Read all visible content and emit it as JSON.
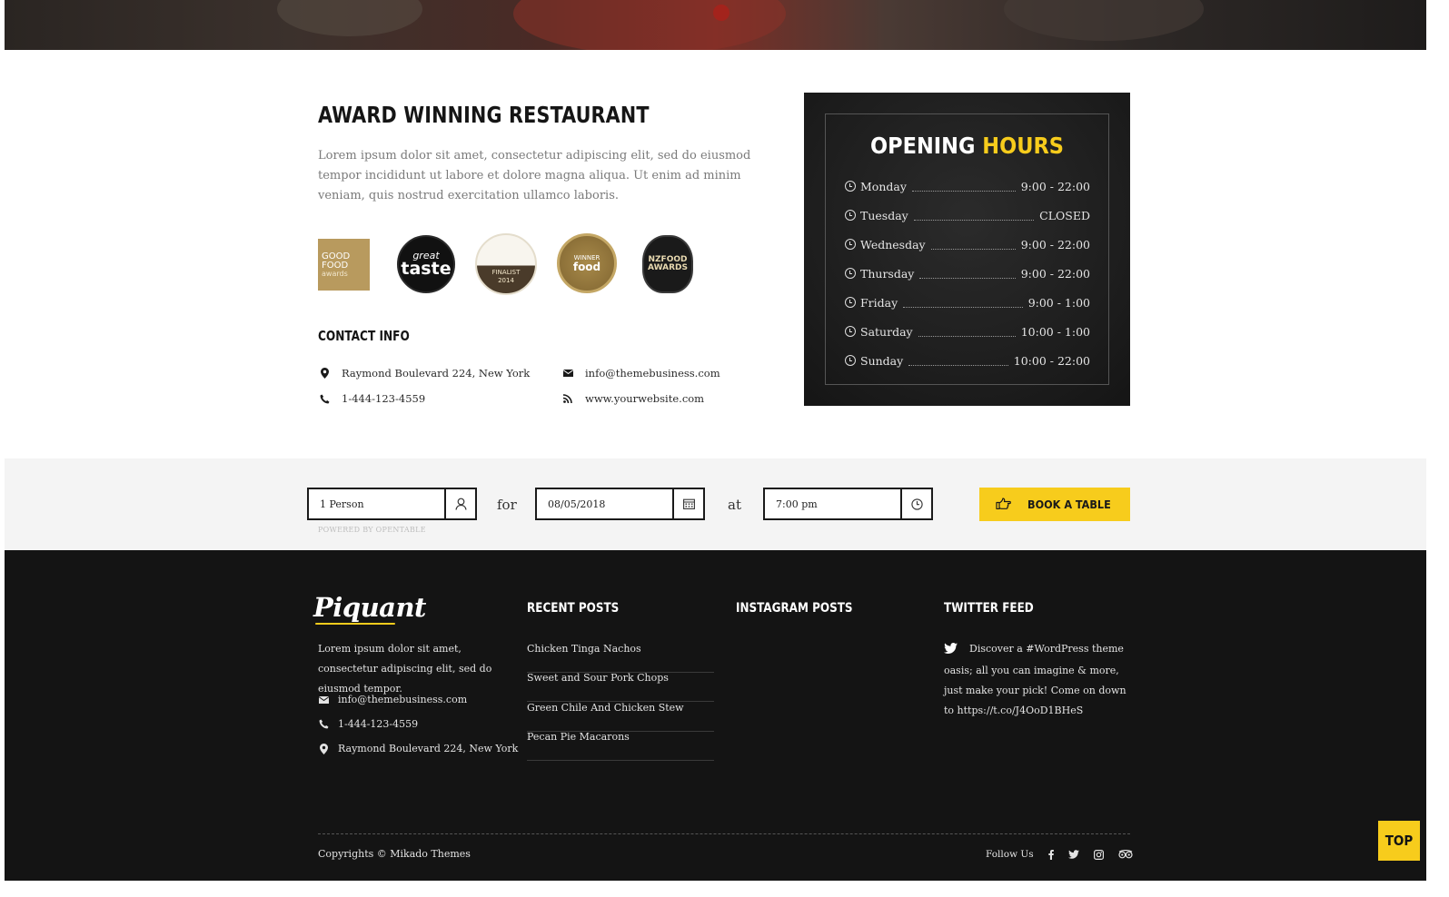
{
  "about": {
    "title": "AWARD WINNING RESTAURANT",
    "text": "Lorem ipsum dolor sit amet, consectetur adipiscing elit, sed do eiusmod tempor incididunt ut labore et dolore magna aliqua. Ut enim ad minim veniam, quis nostrud exercitation ullamco laboris.",
    "badges": [
      {
        "name": "good-food-awards-badge",
        "lines": [
          "GOOD",
          "FOOD",
          "awards"
        ]
      },
      {
        "name": "great-taste-badge",
        "lines": [
          "great",
          "taste"
        ]
      },
      {
        "name": "finalist-2014-badge",
        "lines": [
          "FINALIST",
          "2014"
        ]
      },
      {
        "name": "winner-food-awards-badge",
        "lines": [
          "WINNER",
          "food"
        ]
      },
      {
        "name": "nz-food-awards-badge",
        "lines": [
          "NZFOOD",
          "AWARDS"
        ]
      }
    ],
    "contact_title": "CONTACT INFO",
    "address": "Raymond Boulevard 224, New York",
    "email": "info@themebusiness.com",
    "phone": "1-444-123-4559",
    "website": "www.yourwebsite.com"
  },
  "hours": {
    "title_main": "OPENING",
    "title_highlight": "HOURS",
    "rows": [
      {
        "day": "Monday",
        "time": "9:00 - 22:00"
      },
      {
        "day": "Tuesday",
        "time": "CLOSED"
      },
      {
        "day": "Wednesday",
        "time": "9:00 - 22:00"
      },
      {
        "day": "Thursday",
        "time": "9:00 - 22:00"
      },
      {
        "day": "Friday",
        "time": "9:00 - 1:00"
      },
      {
        "day": "Saturday",
        "time": "10:00 - 1:00"
      },
      {
        "day": "Sunday",
        "time": "10:00 - 22:00"
      }
    ]
  },
  "booking": {
    "people": "1 Person",
    "for_label": "for",
    "date": "08/05/2018",
    "at_label": "at",
    "time": "7:00 pm",
    "button": "BOOK A TABLE",
    "powered": "POWERED BY OPENTABLE"
  },
  "footer": {
    "logo": "Piquant",
    "text": "Lorem ipsum dolor sit amet, consectetur adipiscing elit, sed do eiusmod tempor.",
    "email": "info@themebusiness.com",
    "phone": "1-444-123-4559",
    "address": "Raymond Boulevard 224, New York",
    "recent_title": "RECENT POSTS",
    "posts": [
      "Chicken Tinga Nachos",
      "Sweet and Sour Pork Chops",
      "Green Chile And Chicken Stew",
      "Pecan Pie Macarons"
    ],
    "instagram_title": "INSTAGRAM POSTS",
    "twitter_title": "TWITTER FEED",
    "tweet": "Discover a #WordPress theme oasis; all you can imagine & more, just make your pick! Come on down to https://t.co/J4OoD1BHeS",
    "copyright": "Copyrights © Mikado Themes",
    "follow": "Follow Us",
    "top": "TOP"
  },
  "colors": {
    "accent": "#f7cc1c",
    "footer_bg": "#141414",
    "hours_bg": "#1c1c1c"
  }
}
